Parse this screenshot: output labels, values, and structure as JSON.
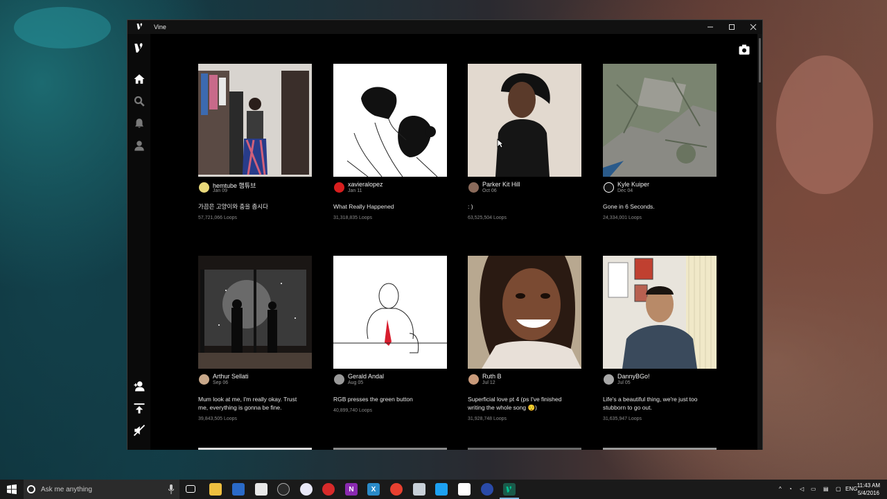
{
  "window": {
    "title": "Vine"
  },
  "posts": [
    {
      "user": "hemtube 햄튜브",
      "date": "Jan 09",
      "caption": "가끔은 고양이와 춤을 춥시다",
      "loops": "57,721,066 Loops"
    },
    {
      "user": "xavieralopez",
      "date": "Jan 11",
      "caption": "What Really Happened",
      "loops": "31,318,835 Loops"
    },
    {
      "user": "Parker Kit Hill",
      "date": "Oct 06",
      "caption": ": )",
      "loops": "63,525,504 Loops"
    },
    {
      "user": "Kyle Kuiper",
      "date": "Dec 04",
      "caption": "Gone in 6 Seconds.",
      "loops": "24,334,001 Loops"
    },
    {
      "user": "Arthur Sellati",
      "date": "Sep 06",
      "caption": "Mum look at me, I'm really okay. Trust me, everything is gonna be fine.",
      "loops": "39,843,505 Loops"
    },
    {
      "user": "Gerald Andal",
      "date": "Aug 05",
      "caption": "RGB presses the green button",
      "loops": "40,899,740 Loops"
    },
    {
      "user": "Ruth B",
      "date": "Jul 12",
      "caption": "Superficial love pt 4 (ps I've finished writing the whole song 😌)",
      "loops": "31,928,748 Loops"
    },
    {
      "user": "DannyBGo!",
      "date": "Jul 05",
      "caption": "Life's a beautiful thing, we're just too stubborn to go out.",
      "loops": "31,635,947 Loops"
    }
  ],
  "taskbar": {
    "search_placeholder": "Ask me anything",
    "language": "ENG",
    "time": "11:43 AM",
    "date": "5/4/2016"
  },
  "colors": {
    "vine_green": "#00bf8f",
    "window_bg": "#000000",
    "taskbar_bg": "#1a1a1a"
  }
}
